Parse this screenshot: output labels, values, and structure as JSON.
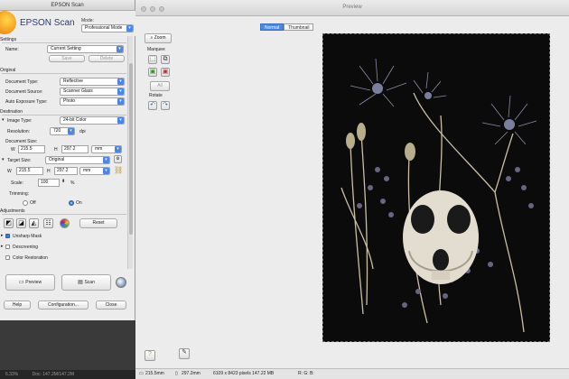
{
  "epson": {
    "title": "EPSON Scan",
    "brand": "EPSON Scan",
    "mode_label": "Mode:",
    "mode_value": "Professional Mode",
    "settings": {
      "section": "Settings",
      "name_label": "Name:",
      "name_value": "Current Setting",
      "save": "Save",
      "delete": "Delete"
    },
    "original": {
      "section": "Original",
      "doc_type_label": "Document Type:",
      "doc_type_value": "Reflective",
      "doc_source_label": "Document Source:",
      "doc_source_value": "Scanner Glass",
      "auto_exp_label": "Auto Exposure Type:",
      "auto_exp_value": "Photo"
    },
    "destination": {
      "section": "Destination",
      "image_type_label": "Image Type:",
      "image_type_value": "24-bit Color",
      "resolution_label": "Resolution:",
      "resolution_value": "720",
      "resolution_unit": "dpi",
      "doc_size_label": "Document Size:",
      "w_label": "W",
      "w_value": "215.5",
      "h_label": "H",
      "h_value": "297.2",
      "unit_value": "mm",
      "target_size_label": "Target Size:",
      "target_size_value": "Original",
      "tw_label": "W",
      "tw_value": "215.5",
      "th_label": "H",
      "th_value": "297.2",
      "tunit_value": "mm",
      "scale_label": "Scale:",
      "scale_value": "100",
      "scale_unit": "%",
      "trimming_label": "Trimming:",
      "trim_off": "Off",
      "trim_on": "On"
    },
    "adjustments": {
      "section": "Adjustments",
      "reset": "Reset",
      "unsharp": "Unsharp Mask",
      "descreening": "Descreening",
      "color_restoration": "Color Restoration"
    },
    "preview_btn": "Preview",
    "scan_btn": "Scan",
    "help_btn": "Help",
    "config_btn": "Configuration...",
    "close_btn": "Close"
  },
  "background_status": {
    "zoom": "6.33%",
    "doc": "Doc: 147.2M/147.2M"
  },
  "preview": {
    "title": "Preview",
    "tabs": [
      "Normal",
      "Thumbnail"
    ],
    "zoom_btn": "Zoom",
    "marquee_label": "Marquee",
    "all_btn": "All",
    "rotate_label": "Rotate",
    "status": {
      "width": "215.5mm",
      "height": "297.2mm",
      "pixels": "6109 x 8423 pixels 147.22 MB",
      "rgb": "R: G: B:"
    }
  },
  "colors": {
    "accent": "#4a89e9",
    "epson_brand": "#2b3b78",
    "scan_background": "#0b0b0b"
  }
}
